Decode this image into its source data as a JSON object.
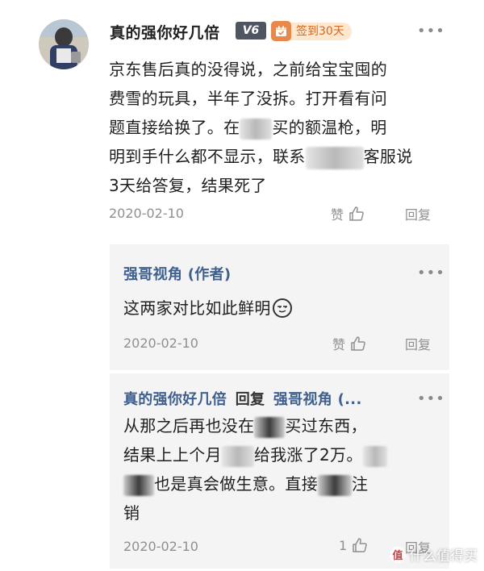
{
  "main_comment": {
    "username": "真的强你好几倍",
    "level": "V6",
    "checkin_label": "签到30天",
    "text_line1": "京东售后真的没得说，之前给宝宝囤的",
    "text_line2": "费雪的玩具，半年了没拆。打开看有问",
    "text_line3a": "题直接给换了。在",
    "text_line3b": "买的额温枪，明",
    "text_line4a": "明到手什么都不显示，联系",
    "text_line4b": "客服说",
    "text_line5": "3天给答复，结果死了",
    "date": "2020-02-10",
    "like_label": "赞",
    "reply_label": "回复"
  },
  "replies": [
    {
      "author": "强哥视角 (作者)",
      "text": "这两家对比如此鲜明",
      "date": "2020-02-10",
      "like_label": "赞",
      "reply_label": "回复"
    },
    {
      "author": "真的强你好几倍",
      "reply_word": "回复",
      "target": "强哥视角 (...",
      "line1a": "从那之后再也没在",
      "line1b": "买过东西，",
      "line2a": "结果上上个月",
      "line2b": "给我涨了2万。",
      "line3a": "也是真会做生意。直接",
      "line3b": "注",
      "line4": "销",
      "date": "2020-02-10",
      "like_count": "1",
      "reply_label": "回复"
    }
  ],
  "watermark": {
    "icon_text": "值",
    "label": "什么值得买"
  },
  "colors": {
    "author_link": "#3f5f8e",
    "checkin_accent": "#d9671f",
    "meta_grey": "#8f8f8f",
    "reply_bg": "#f4f4f4"
  }
}
